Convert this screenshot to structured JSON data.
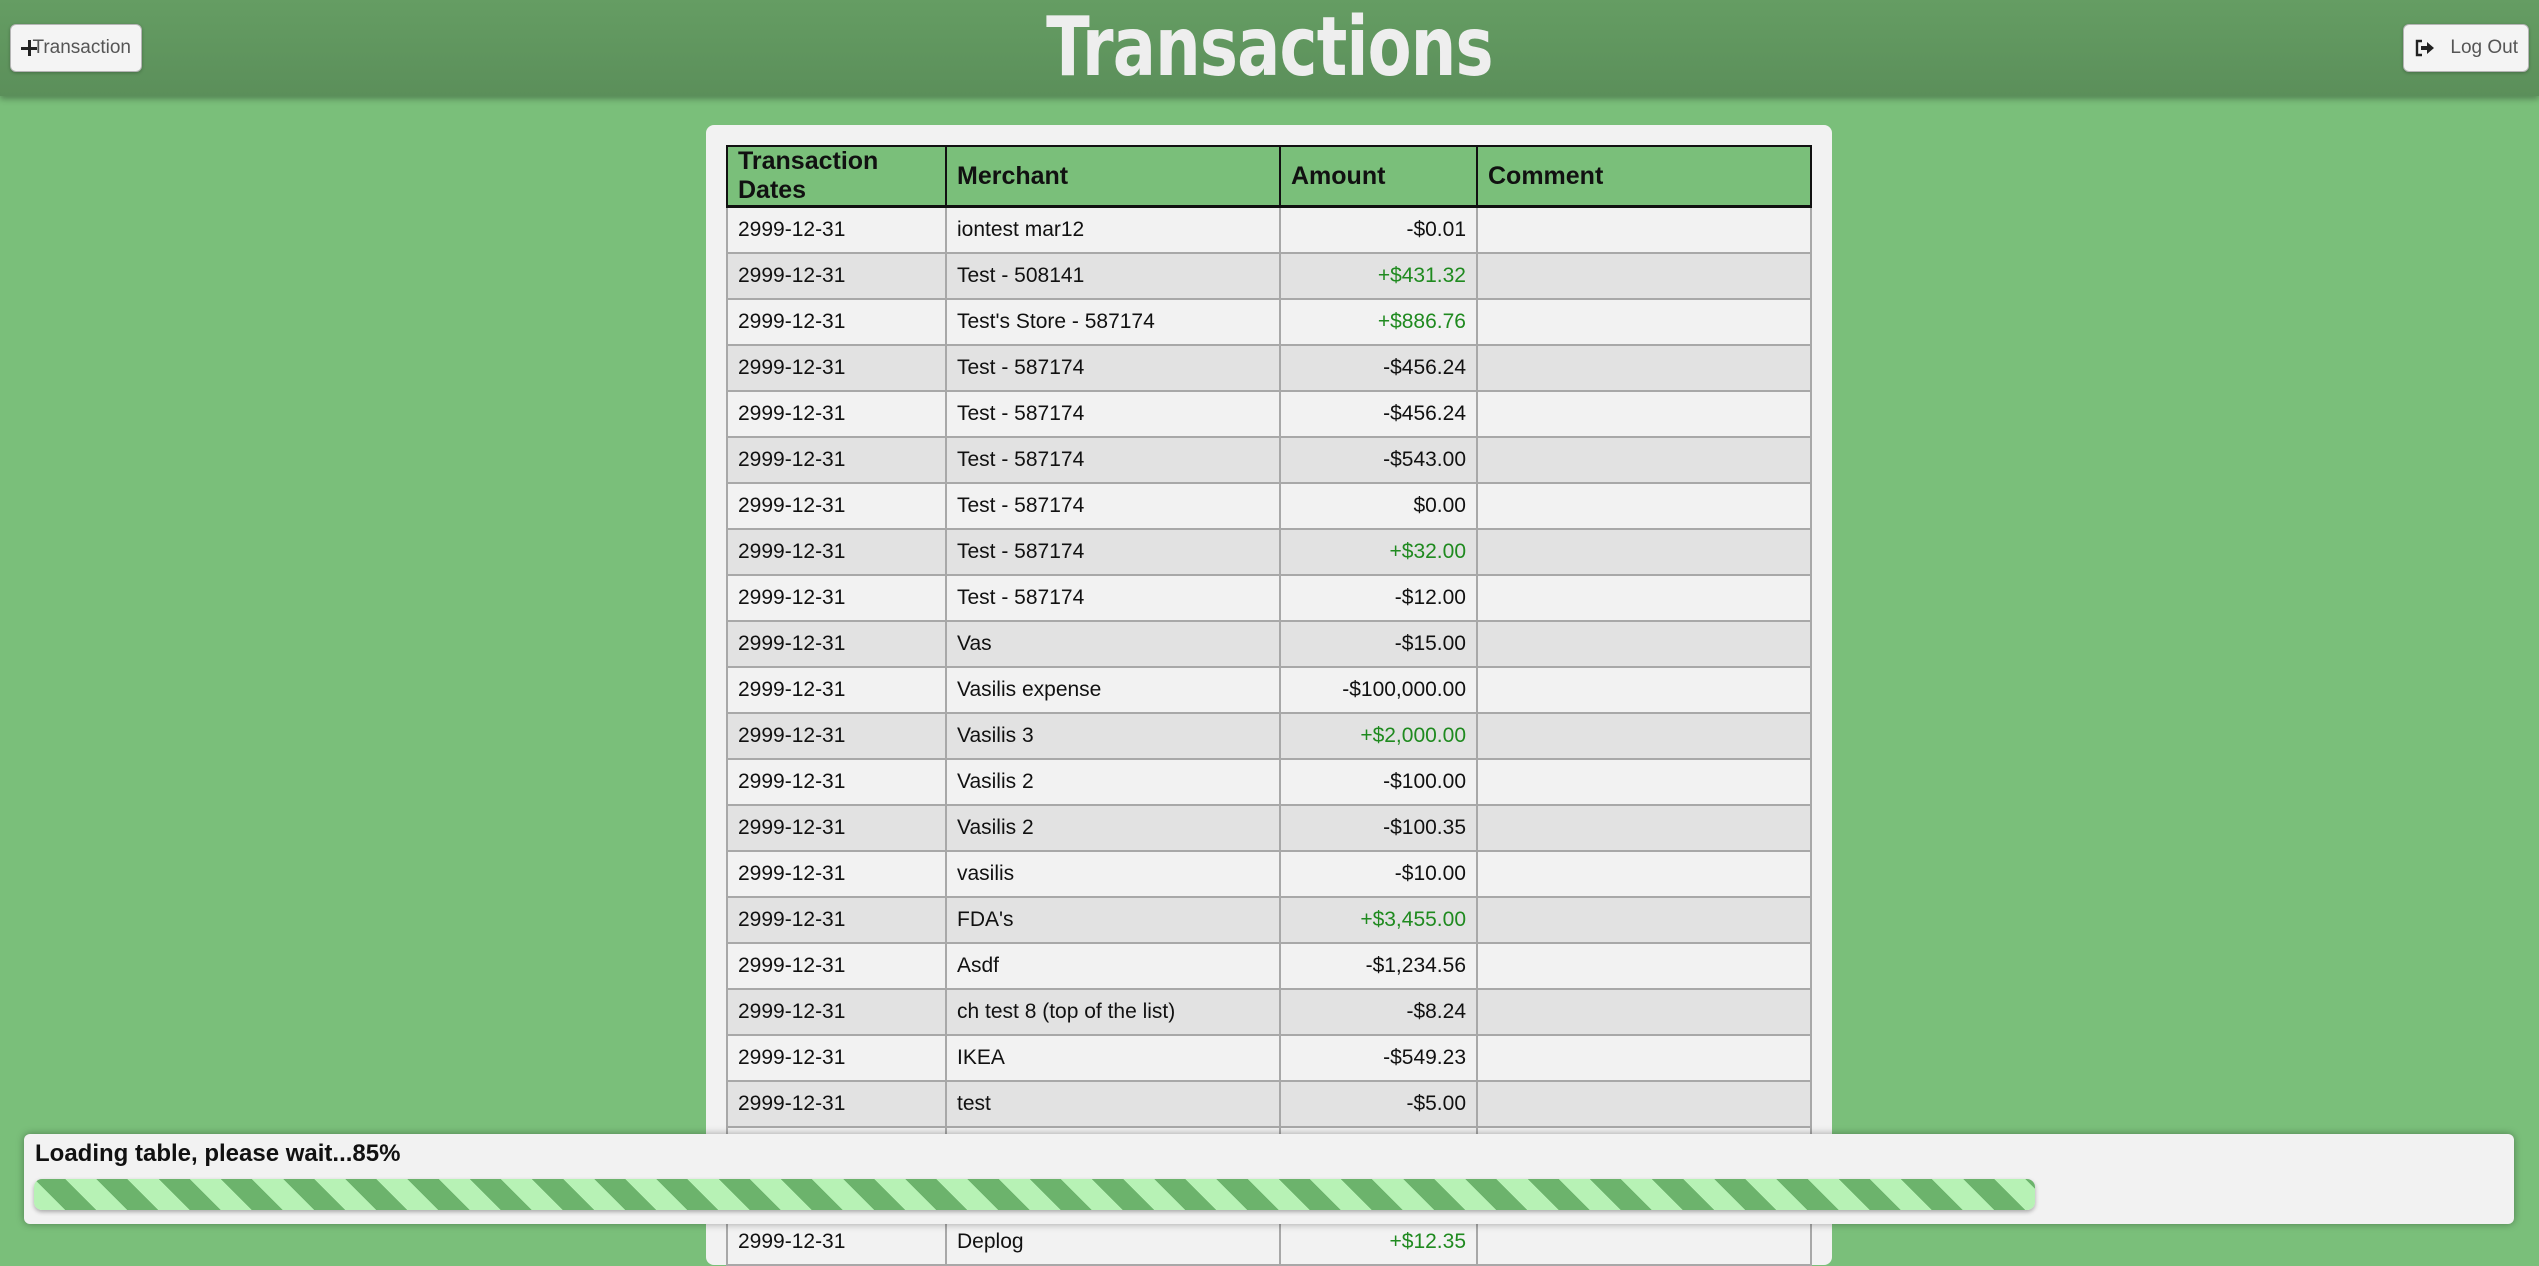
{
  "header": {
    "title": "Transactions",
    "add_button_label": "Transaction",
    "logout_button_label": "Log Out"
  },
  "colors": {
    "background": "#7abf7a",
    "header": "#5e935d",
    "positive_amount": "#1f8a1f"
  },
  "table": {
    "columns": [
      "Transaction Dates",
      "Merchant",
      "Amount",
      "Comment"
    ],
    "rows": [
      {
        "date": "2999-12-31",
        "merchant": "iontest mar12",
        "amount": "-$0.01",
        "comment": ""
      },
      {
        "date": "2999-12-31",
        "merchant": "Test - 508141",
        "amount": "+$431.32",
        "comment": ""
      },
      {
        "date": "2999-12-31",
        "merchant": "Test's Store - 587174",
        "amount": "+$886.76",
        "comment": ""
      },
      {
        "date": "2999-12-31",
        "merchant": "Test - 587174",
        "amount": "-$456.24",
        "comment": ""
      },
      {
        "date": "2999-12-31",
        "merchant": "Test - 587174",
        "amount": "-$456.24",
        "comment": ""
      },
      {
        "date": "2999-12-31",
        "merchant": "Test - 587174",
        "amount": "-$543.00",
        "comment": ""
      },
      {
        "date": "2999-12-31",
        "merchant": "Test - 587174",
        "amount": "$0.00",
        "comment": ""
      },
      {
        "date": "2999-12-31",
        "merchant": "Test - 587174",
        "amount": "+$32.00",
        "comment": ""
      },
      {
        "date": "2999-12-31",
        "merchant": "Test - 587174",
        "amount": "-$12.00",
        "comment": ""
      },
      {
        "date": "2999-12-31",
        "merchant": "Vas",
        "amount": "-$15.00",
        "comment": ""
      },
      {
        "date": "2999-12-31",
        "merchant": "Vasilis expense",
        "amount": "-$100,000.00",
        "comment": ""
      },
      {
        "date": "2999-12-31",
        "merchant": "Vasilis 3",
        "amount": "+$2,000.00",
        "comment": ""
      },
      {
        "date": "2999-12-31",
        "merchant": "Vasilis 2",
        "amount": "-$100.00",
        "comment": ""
      },
      {
        "date": "2999-12-31",
        "merchant": "Vasilis 2",
        "amount": "-$100.35",
        "comment": ""
      },
      {
        "date": "2999-12-31",
        "merchant": "vasilis",
        "amount": "-$10.00",
        "comment": ""
      },
      {
        "date": "2999-12-31",
        "merchant": "FDA's",
        "amount": "+$3,455.00",
        "comment": ""
      },
      {
        "date": "2999-12-31",
        "merchant": "Asdf",
        "amount": "-$1,234.56",
        "comment": ""
      },
      {
        "date": "2999-12-31",
        "merchant": "ch test 8 (top of the list)",
        "amount": "-$8.24",
        "comment": ""
      },
      {
        "date": "2999-12-31",
        "merchant": "IKEA",
        "amount": "-$549.23",
        "comment": ""
      },
      {
        "date": "2999-12-31",
        "merchant": "test",
        "amount": "-$5.00",
        "comment": ""
      },
      {
        "date": "",
        "merchant": "",
        "amount": "",
        "comment": ""
      },
      {
        "date": "",
        "merchant": "",
        "amount": "",
        "comment": ""
      },
      {
        "date": "2999-12-31",
        "merchant": "Deplog",
        "amount": "+$12.35",
        "comment": ""
      }
    ]
  },
  "loader": {
    "message": "Loading table, please wait...85%",
    "progress_percent": 81
  }
}
